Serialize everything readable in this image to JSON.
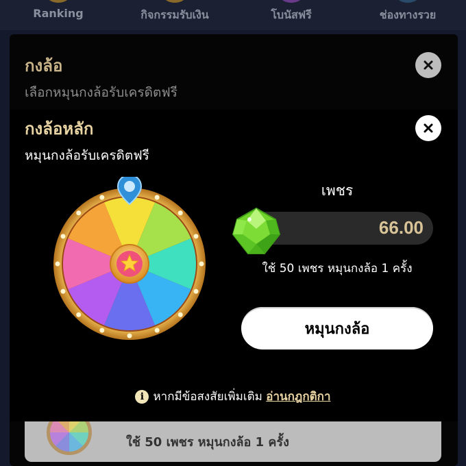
{
  "nav": {
    "items": [
      {
        "label": "Ranking",
        "icon": "trophy-icon"
      },
      {
        "label": "กิจกรรมรับเงิน",
        "icon": "coins-icon"
      },
      {
        "label": "โบนัสฟรี",
        "icon": "gift-icon"
      },
      {
        "label": "ช่องทางรวย",
        "icon": "money-icon"
      }
    ]
  },
  "outer_dialog": {
    "title": "กงล้อ",
    "subtitle": "เลือกหมุนกงล้อรับเครดิตฟรี",
    "close_icon": "close-icon"
  },
  "background_card": {
    "text": "ใช้ 50 เพชร หมุนกงล้อ 1 ครั้ง"
  },
  "inner_dialog": {
    "title": "กงล้อหลัก",
    "subtitle": "หมุนกงล้อรับเครดิตฟรี",
    "close_icon": "close-icon",
    "wheel": {
      "segment_colors": [
        "#f5e03a",
        "#a6e04a",
        "#3ee0c0",
        "#38b4f5",
        "#6a6ff0",
        "#b45cf0",
        "#f06bb0",
        "#f5a43a"
      ],
      "rim_color": "#e0a43a",
      "center_icon": "star-icon",
      "pointer_icon": "map-pin-icon"
    },
    "gem": {
      "label": "เพชร",
      "value": "66.00",
      "icon": "gem-icon"
    },
    "cost_note": "ใช้ 50 เพชร หมุนกงล้อ 1 ครั้ง",
    "spin_button": "หมุนกงล้อ",
    "info": {
      "text": "หากมีข้อสงสัยเพิ่มเติม",
      "link": "อ่านกฎกติกา",
      "icon": "info-icon"
    }
  },
  "colors": {
    "accent_gold": "#e8d3a2",
    "gem_value": "#d8c497",
    "dialog_bg": "#000000",
    "page_bg": "#141a2c"
  }
}
